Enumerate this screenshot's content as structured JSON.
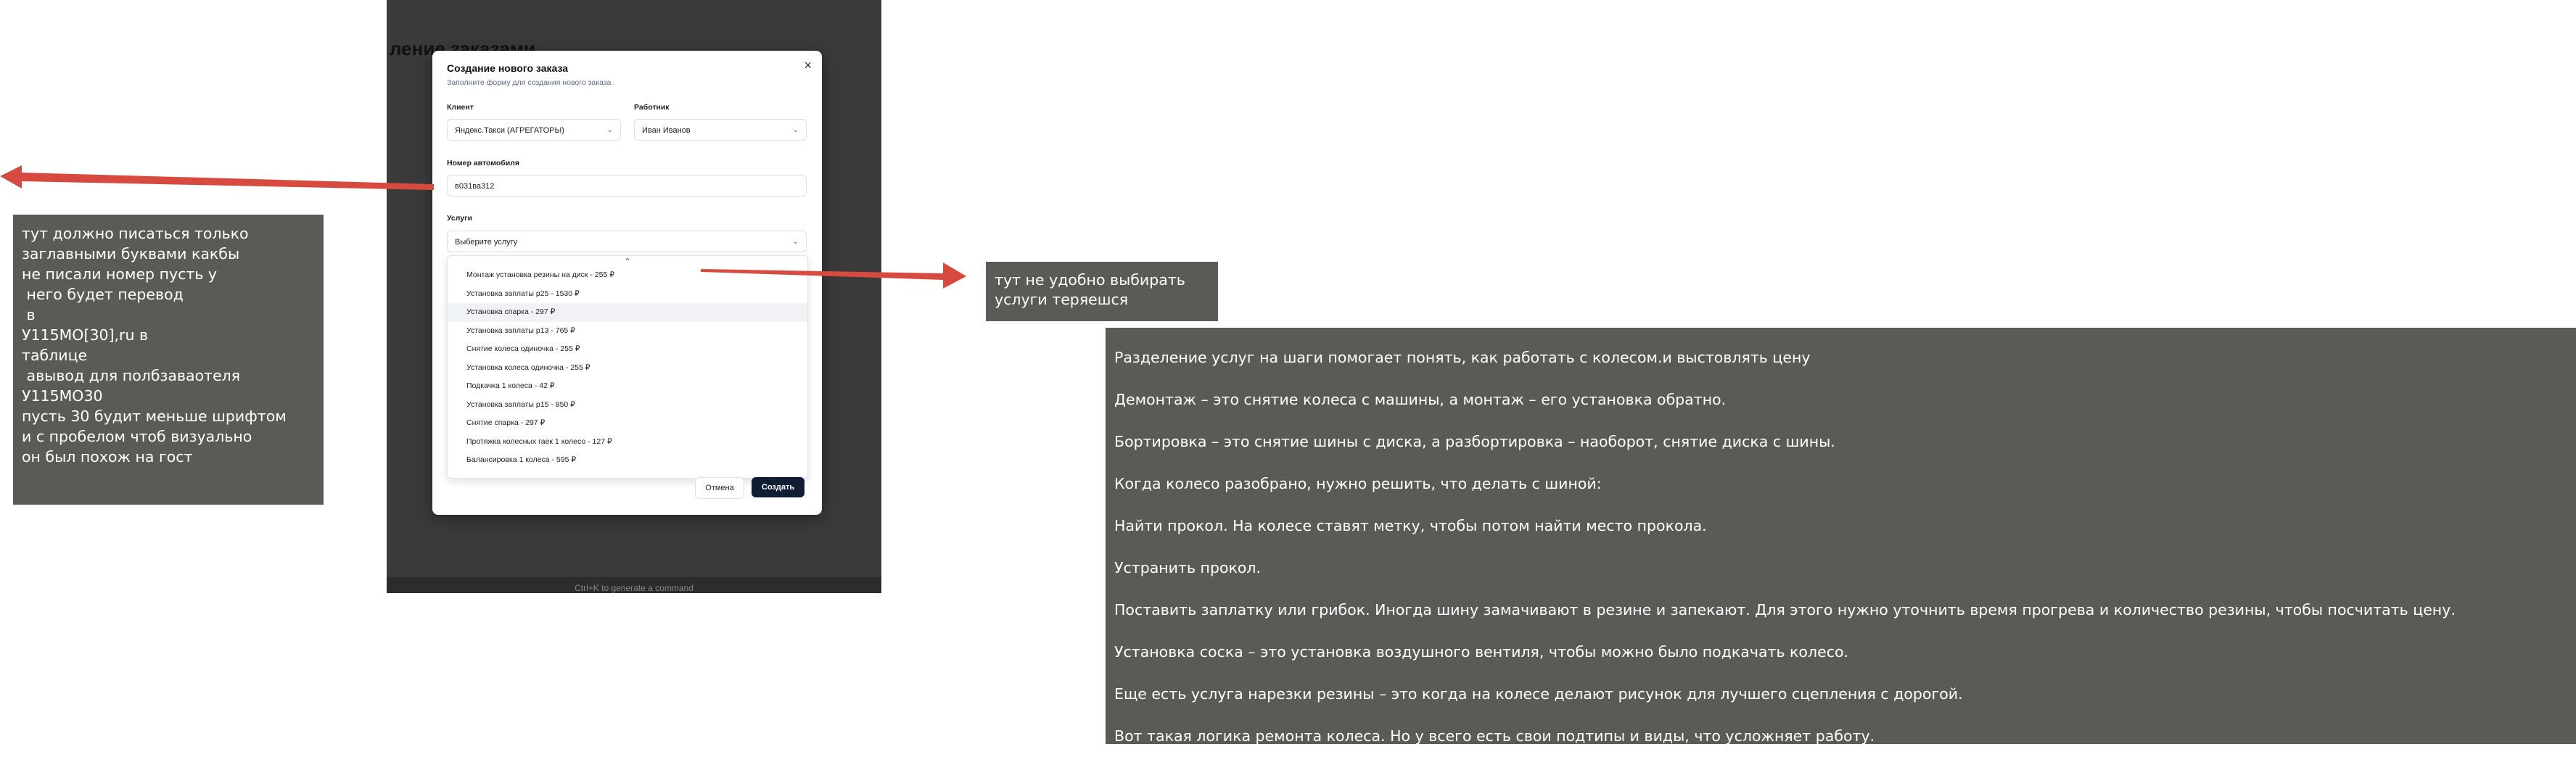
{
  "background": {
    "page_title": "ление заказами",
    "cmd_hint": "Ctrl+K to generate a command"
  },
  "modal": {
    "title": "Создание нового заказа",
    "subtitle": "Заполните форму для создания нового заказа",
    "close_icon": "close-icon",
    "client_label": "Клиент",
    "client_value": "Яндекс.Такси (АГРЕГАТОРЫ)",
    "worker_label": "Работник",
    "worker_value": "Иван Иванов",
    "car_label": "Номер автомобиля",
    "car_value": "в031ва312",
    "services_label": "Услуги",
    "services_placeholder": "Выберите услугу",
    "dropdown_items": [
      "Монтаж установка резины на диск - 255 ₽",
      "Установка заплаты p25 - 1530 ₽",
      "Установка спарка - 297 ₽",
      "Установка заплаты p13 - 765 ₽",
      "Снятие колеса одиночка - 255 ₽",
      "Установка колеса одиночка - 255 ₽",
      "Подкачка 1 колеса - 42 ₽",
      "Установка заплаты p15 - 850 ₽",
      "Снятие спарка - 297 ₽",
      "Протяжка колесных гаек 1 колесо - 127 ₽",
      "Балансировка 1 колеса - 595 ₽"
    ],
    "cancel_label": "Отмена",
    "create_label": "Создать"
  },
  "notes": {
    "left": [
      "тут должно писаться только",
      "заглавными буквами какбы",
      "не писали номер пусть у",
      " него будет перевод",
      " в",
      "У115МО[30],ru в",
      "таблице",
      " авывод для полбзаваотеля",
      "У115МО30",
      "пусть 30 будит меньше шрифтом",
      "и с пробелом чтоб визуально",
      "он был похож на гост"
    ],
    "middle": [
      "тут не удобно выбирать",
      "услуги теряешся"
    ],
    "right": [
      "Разделение услуг на шаги помогает понять, как работать с колесом.и выстовлять цену",
      "Демонтаж – это снятие колеса с машины, а монтаж – его установка обратно.",
      "Бортировка – это снятие шины с диска, а разбортировка – наоборот, снятие диска с шины.",
      "Когда колесо разобрано, нужно решить, что делать с шиной:",
      "Найти прокол. На колесе ставят метку, чтобы потом найти место прокола.",
      "Устранить прокол.",
      "Поставить заплатку или грибок. Иногда шину замачивают в резине и запекают. Для этого нужно уточнить время прогрева и количество резины, чтобы посчитать цену.",
      "Установка соска – это установка воздушного вентиля, чтобы можно было подкачать колесо.",
      "Еще есть услуга нарезки резины – это когда на колесе делают рисунок для лучшего сцепления с дорогой.",
      "Вот такая логика ремонта колеса. Но у всего есть свои подтипы и виды, что усложняет работу."
    ]
  },
  "colors": {
    "arrow": "#d64a3f",
    "note_bg": "#5b5a57",
    "primary_button": "#0f1e33"
  }
}
